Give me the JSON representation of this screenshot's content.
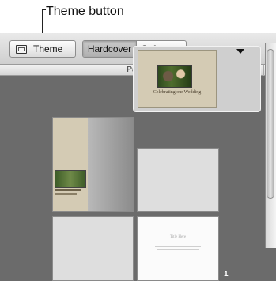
{
  "callout": {
    "label": "Theme button"
  },
  "toolbar": {
    "theme_label": "Theme",
    "cover_types": [
      {
        "label": "Hardcover",
        "selected": true
      },
      {
        "label": "Softcover",
        "selected": false
      }
    ]
  },
  "pages_panel": {
    "header": "Pages",
    "cover_caption": "Celebrating our Wedding",
    "page_title_mock": "Title Here",
    "page_number": "1"
  }
}
